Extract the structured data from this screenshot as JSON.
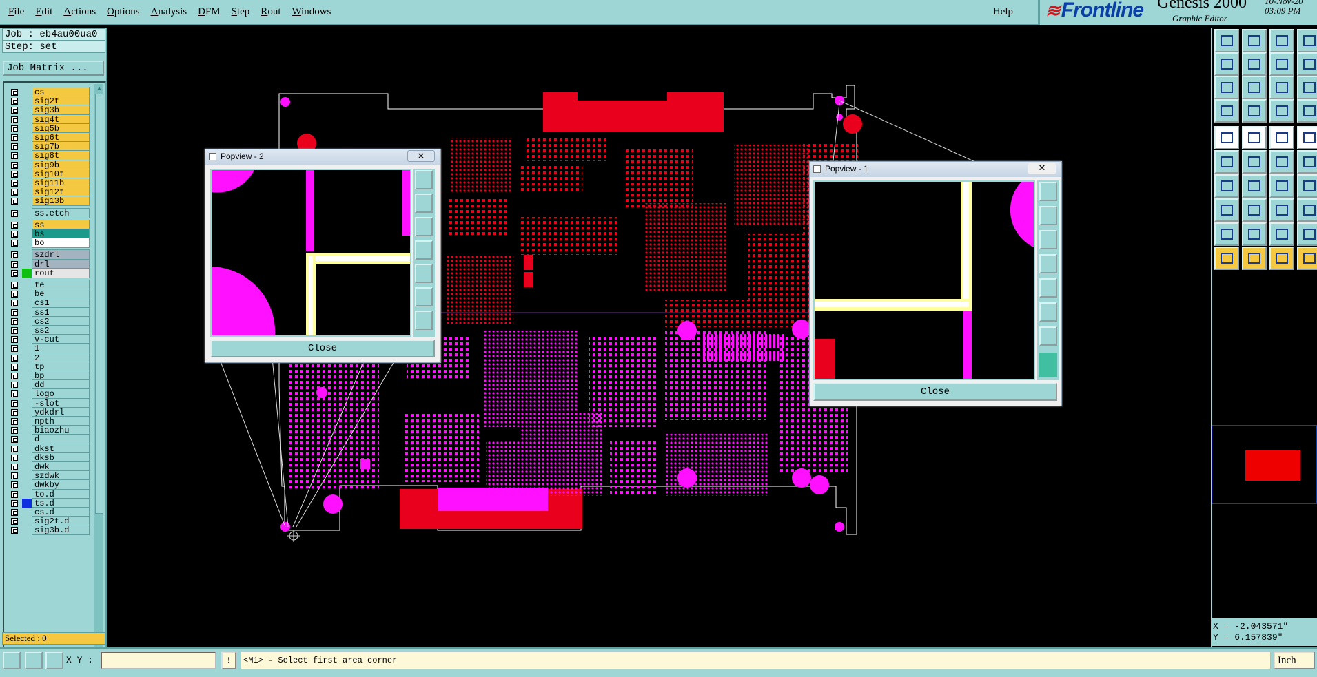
{
  "menu": {
    "items": [
      "File",
      "Edit",
      "Actions",
      "Options",
      "Analysis",
      "DFM",
      "Step",
      "Rout",
      "Windows"
    ],
    "help": "Help"
  },
  "brand": {
    "logo": "Frontline",
    "product": "Genesis 2000",
    "subtitle": "Graphic Editor",
    "date": "10-Nov-20",
    "time": "03:09 PM"
  },
  "job": {
    "job_line": "Job : eb4au00ua0",
    "step_line": "Step: set",
    "matrix_button": "Job Matrix ..."
  },
  "layers": [
    {
      "name": "cs",
      "color": "#f5c842"
    },
    {
      "name": "sig2t",
      "color": "#f5c842"
    },
    {
      "name": "sig3b",
      "color": "#f5c842"
    },
    {
      "name": "sig4t",
      "color": "#f5c842"
    },
    {
      "name": "sig5b",
      "color": "#f5c842"
    },
    {
      "name": "sig6t",
      "color": "#f5c842"
    },
    {
      "name": "sig7b",
      "color": "#f5c842"
    },
    {
      "name": "sig8t",
      "color": "#f5c842"
    },
    {
      "name": "sig9b",
      "color": "#f5c842"
    },
    {
      "name": "sig10t",
      "color": "#f5c842"
    },
    {
      "name": "sig11b",
      "color": "#f5c842"
    },
    {
      "name": "sig12t",
      "color": "#f5c842"
    },
    {
      "name": "sig13b",
      "color": "#f5c842"
    },
    {
      "name": "ss.etch",
      "color": "#9ed5d5",
      "gap": true
    },
    {
      "name": "ss",
      "color": "#f5c842",
      "gap": true
    },
    {
      "name": "bs",
      "color": "#1a9a8a"
    },
    {
      "name": "bo",
      "color": "#ffffff"
    },
    {
      "name": "szdrl",
      "color": "#a3b3bf",
      "gap": true
    },
    {
      "name": "drl",
      "color": "#a3b3bf"
    },
    {
      "name": "rout",
      "color": "#e5e5e5",
      "indicator": "#10c010"
    },
    {
      "name": "te",
      "color": "#9ed5d5",
      "gap": true
    },
    {
      "name": "be",
      "color": "#9ed5d5"
    },
    {
      "name": "cs1",
      "color": "#9ed5d5"
    },
    {
      "name": "ss1",
      "color": "#9ed5d5"
    },
    {
      "name": "cs2",
      "color": "#9ed5d5"
    },
    {
      "name": "ss2",
      "color": "#9ed5d5"
    },
    {
      "name": "v-cut",
      "color": "#9ed5d5"
    },
    {
      "name": "1",
      "color": "#9ed5d5"
    },
    {
      "name": "2",
      "color": "#9ed5d5"
    },
    {
      "name": "tp",
      "color": "#9ed5d5"
    },
    {
      "name": "bp",
      "color": "#9ed5d5"
    },
    {
      "name": "dd",
      "color": "#9ed5d5"
    },
    {
      "name": "logo",
      "color": "#9ed5d5"
    },
    {
      "name": "-slot",
      "color": "#9ed5d5"
    },
    {
      "name": "ydkdrl",
      "color": "#9ed5d5"
    },
    {
      "name": "npth",
      "color": "#9ed5d5"
    },
    {
      "name": "biaozhu",
      "color": "#9ed5d5"
    },
    {
      "name": "d",
      "color": "#9ed5d5"
    },
    {
      "name": "dkst",
      "color": "#9ed5d5"
    },
    {
      "name": "dksb",
      "color": "#9ed5d5"
    },
    {
      "name": "dwk",
      "color": "#9ed5d5"
    },
    {
      "name": "szdwk",
      "color": "#9ed5d5"
    },
    {
      "name": "dwkby",
      "color": "#9ed5d5"
    },
    {
      "name": "to.d",
      "color": "#9ed5d5"
    },
    {
      "name": "ts.d",
      "color": "#9ed5d5",
      "indicator": "#1030e0"
    },
    {
      "name": "cs.d",
      "color": "#9ed5d5"
    },
    {
      "name": "sig2t.d",
      "color": "#9ed5d5"
    },
    {
      "name": "sig3b.d",
      "color": "#9ed5d5"
    }
  ],
  "selected": "Selected : 0",
  "popups": {
    "p2": {
      "title": "Popview - 2",
      "close": "Close",
      "x": "✕"
    },
    "p1": {
      "title": "Popview - 1",
      "close": "Close",
      "x": "✕"
    }
  },
  "coords": {
    "x": "X = -2.043571\"",
    "y": "Y = 6.157839\""
  },
  "bottom": {
    "xy_label": "X Y :",
    "xy_value": "",
    "message": "<M1> - Select first area corner",
    "unit": "Inch"
  },
  "colors": {
    "panel": "#9ed5d5",
    "active_layer": "#f5c842",
    "copper": "#e8001c",
    "soldermask": "#ff10ff",
    "highlight": "#ffff80"
  }
}
